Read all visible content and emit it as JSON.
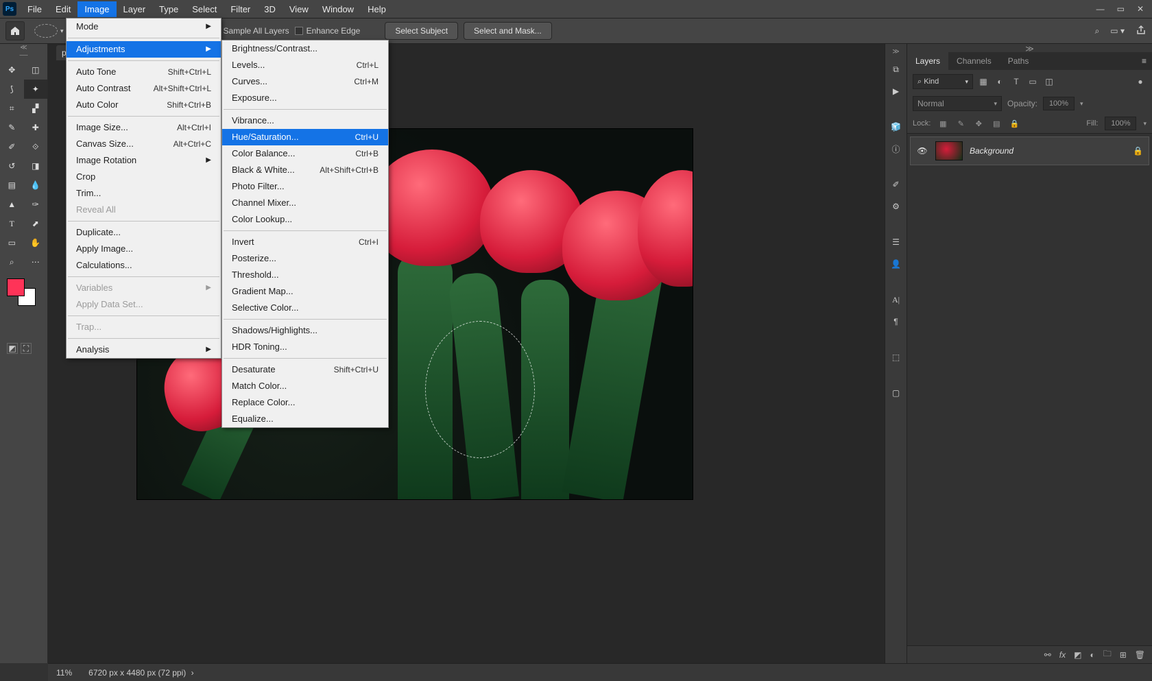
{
  "menubar": [
    "File",
    "Edit",
    "Image",
    "Layer",
    "Type",
    "Select",
    "Filter",
    "3D",
    "View",
    "Window",
    "Help"
  ],
  "menubar_open_index": 2,
  "options": {
    "sample_all": "Sample All Layers",
    "enhance_edge": "Enhance Edge",
    "select_subject": "Select Subject",
    "select_mask": "Select and Mask..."
  },
  "image_menu": [
    {
      "label": "Mode",
      "sub": true
    },
    {
      "sep": true
    },
    {
      "label": "Adjustments",
      "sub": true,
      "hl": true
    },
    {
      "sep": true
    },
    {
      "label": "Auto Tone",
      "sc": "Shift+Ctrl+L"
    },
    {
      "label": "Auto Contrast",
      "sc": "Alt+Shift+Ctrl+L"
    },
    {
      "label": "Auto Color",
      "sc": "Shift+Ctrl+B"
    },
    {
      "sep": true
    },
    {
      "label": "Image Size...",
      "sc": "Alt+Ctrl+I"
    },
    {
      "label": "Canvas Size...",
      "sc": "Alt+Ctrl+C"
    },
    {
      "label": "Image Rotation",
      "sub": true
    },
    {
      "label": "Crop"
    },
    {
      "label": "Trim..."
    },
    {
      "label": "Reveal All",
      "disabled": true
    },
    {
      "sep": true
    },
    {
      "label": "Duplicate..."
    },
    {
      "label": "Apply Image..."
    },
    {
      "label": "Calculations..."
    },
    {
      "sep": true
    },
    {
      "label": "Variables",
      "sub": true,
      "disabled": true
    },
    {
      "label": "Apply Data Set...",
      "disabled": true
    },
    {
      "sep": true
    },
    {
      "label": "Trap...",
      "disabled": true
    },
    {
      "sep": true
    },
    {
      "label": "Analysis",
      "sub": true
    }
  ],
  "adjust_menu": [
    {
      "label": "Brightness/Contrast..."
    },
    {
      "label": "Levels...",
      "sc": "Ctrl+L"
    },
    {
      "label": "Curves...",
      "sc": "Ctrl+M"
    },
    {
      "label": "Exposure..."
    },
    {
      "sep": true
    },
    {
      "label": "Vibrance..."
    },
    {
      "label": "Hue/Saturation...",
      "sc": "Ctrl+U",
      "hl": true
    },
    {
      "label": "Color Balance...",
      "sc": "Ctrl+B"
    },
    {
      "label": "Black & White...",
      "sc": "Alt+Shift+Ctrl+B"
    },
    {
      "label": "Photo Filter..."
    },
    {
      "label": "Channel Mixer..."
    },
    {
      "label": "Color Lookup..."
    },
    {
      "sep": true
    },
    {
      "label": "Invert",
      "sc": "Ctrl+I"
    },
    {
      "label": "Posterize..."
    },
    {
      "label": "Threshold..."
    },
    {
      "label": "Gradient Map..."
    },
    {
      "label": "Selective Color..."
    },
    {
      "sep": true
    },
    {
      "label": "Shadows/Highlights..."
    },
    {
      "label": "HDR Toning..."
    },
    {
      "sep": true
    },
    {
      "label": "Desaturate",
      "sc": "Shift+Ctrl+U"
    },
    {
      "label": "Match Color..."
    },
    {
      "label": "Replace Color..."
    },
    {
      "label": "Equalize..."
    }
  ],
  "layers_panel": {
    "tabs": [
      "Layers",
      "Channels",
      "Paths"
    ],
    "active_tab": 0,
    "kind_label": "Kind",
    "search_glyph": "⌕",
    "blend_mode": "Normal",
    "opacity_label": "Opacity:",
    "opacity_value": "100%",
    "lock_label": "Lock:",
    "fill_label": "Fill:",
    "fill_value": "100%",
    "layer_name": "Background"
  },
  "status": {
    "zoom": "11%",
    "docinfo": "6720 px x 4480 px (72 ppi)"
  },
  "doc_tab": "p",
  "ps": "Ps"
}
